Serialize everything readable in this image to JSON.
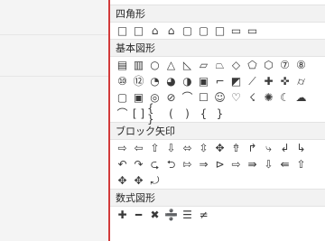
{
  "categories": [
    {
      "label": "四角形",
      "rows": [
        [
          "□",
          "□",
          "⌂",
          "⌂",
          "▢",
          "▢",
          "□",
          "▭",
          "▭"
        ]
      ]
    },
    {
      "label": "基本図形",
      "rows": [
        [
          "▤",
          "▥",
          "○",
          "△",
          "◺",
          "▱",
          "⏢",
          "◇",
          "⬠",
          "⬡",
          "⑦",
          "⑧"
        ],
        [
          "⑩",
          "⑫",
          "◔",
          "◕",
          "◑",
          "▣",
          "⌐",
          "◩",
          "⟋",
          "✚",
          "✜",
          "⌭"
        ],
        [
          "▢",
          "▣",
          "◎",
          "⊘",
          "⌒",
          "☐",
          "☺",
          "♡",
          "☇",
          "✺",
          "☾",
          "☁"
        ],
        [
          "⌒",
          "[ ]",
          "{ }",
          "(",
          ")",
          "{",
          "}"
        ]
      ]
    },
    {
      "label": "ブロック矢印",
      "rows": [
        [
          "⇨",
          "⇦",
          "⇧",
          "⇩",
          "⬄",
          "⇳",
          "✥",
          "⇮",
          "↱",
          "⤷",
          "↲",
          "↳"
        ],
        [
          "↶",
          "↷",
          "⮎",
          "⮌",
          "⇰",
          "⇒",
          "⊳",
          "⇨",
          "⇛",
          "⇩",
          "⇚",
          "⇧"
        ],
        [
          "✥",
          "✥",
          "⤾"
        ]
      ]
    },
    {
      "label": "数式図形",
      "rows": [
        [
          "✚",
          "━",
          "✖",
          "➗",
          "☰",
          "≠"
        ]
      ]
    }
  ]
}
